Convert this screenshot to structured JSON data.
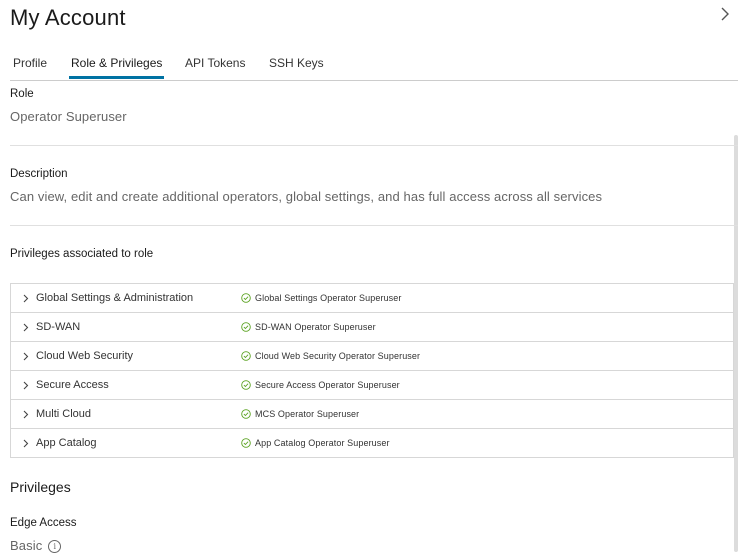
{
  "header": {
    "title": "My Account"
  },
  "tabs": [
    {
      "label": "Profile"
    },
    {
      "label": "Role & Privileges"
    },
    {
      "label": "API Tokens"
    },
    {
      "label": "SSH Keys"
    }
  ],
  "role": {
    "label": "Role",
    "value": "Operator Superuser"
  },
  "description": {
    "label": "Description",
    "value": "Can view, edit and create additional operators, global settings, and has full access across all services"
  },
  "privileges_associated": {
    "label": "Privileges associated to role",
    "rows": [
      {
        "name": "Global Settings & Administration",
        "status": "Global Settings Operator Superuser"
      },
      {
        "name": "SD-WAN",
        "status": "SD-WAN Operator Superuser"
      },
      {
        "name": "Cloud Web Security",
        "status": "Cloud Web Security Operator Superuser"
      },
      {
        "name": "Secure Access",
        "status": "Secure Access Operator Superuser"
      },
      {
        "name": "Multi Cloud",
        "status": "MCS Operator Superuser"
      },
      {
        "name": "App Catalog",
        "status": "App Catalog Operator Superuser"
      }
    ]
  },
  "privileges": {
    "title": "Privileges",
    "edge_access_label": "Edge Access",
    "edge_access_value": "Basic",
    "info_glyph": "i"
  },
  "colors": {
    "accent": "#0072a3",
    "success": "#5aa220"
  },
  "icons": {
    "close": "chevron-right-icon",
    "row_expand": "chevron-right-icon",
    "status": "check-circle-icon",
    "info": "info-icon"
  }
}
